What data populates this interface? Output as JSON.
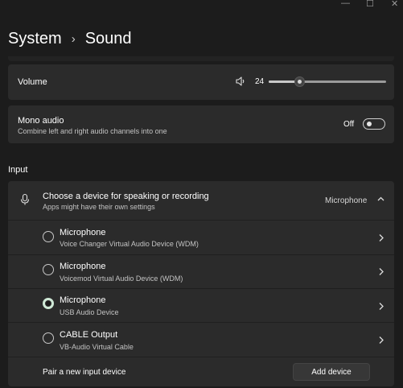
{
  "window": {
    "minimize_glyph": "—",
    "maximize_glyph": "☐",
    "close_glyph": "✕"
  },
  "breadcrumb": {
    "parent": "System",
    "separator": "›",
    "current": "Sound"
  },
  "volume": {
    "label": "Volume",
    "value": "24",
    "level": 0.24
  },
  "mono_audio": {
    "label": "Mono audio",
    "description": "Combine left and right audio channels into one",
    "state": "Off"
  },
  "input": {
    "section_title": "Input",
    "chooser": {
      "title": "Choose a device for speaking or recording",
      "subtitle": "Apps might have their own settings",
      "selected": "Microphone"
    },
    "devices": [
      {
        "name": "Microphone",
        "description": "Voice Changer Virtual Audio Device (WDM)",
        "selected": false
      },
      {
        "name": "Microphone",
        "description": "Voicemod Virtual Audio Device (WDM)",
        "selected": false
      },
      {
        "name": "Microphone",
        "description": "USB Audio Device",
        "selected": true
      },
      {
        "name": "CABLE Output",
        "description": "VB-Audio Virtual Cable",
        "selected": false
      }
    ],
    "pair": {
      "label": "Pair a new input device",
      "button": "Add device"
    }
  },
  "icons": {
    "speaker": "speaker-icon",
    "microphone": "microphone-icon",
    "chevron": "chevron-right-icon",
    "chevron_up": "chevron-up-icon"
  },
  "colors": {
    "background": "#1c1c1c",
    "card": "#2b2b2b",
    "accent": "#cfe9d6"
  }
}
